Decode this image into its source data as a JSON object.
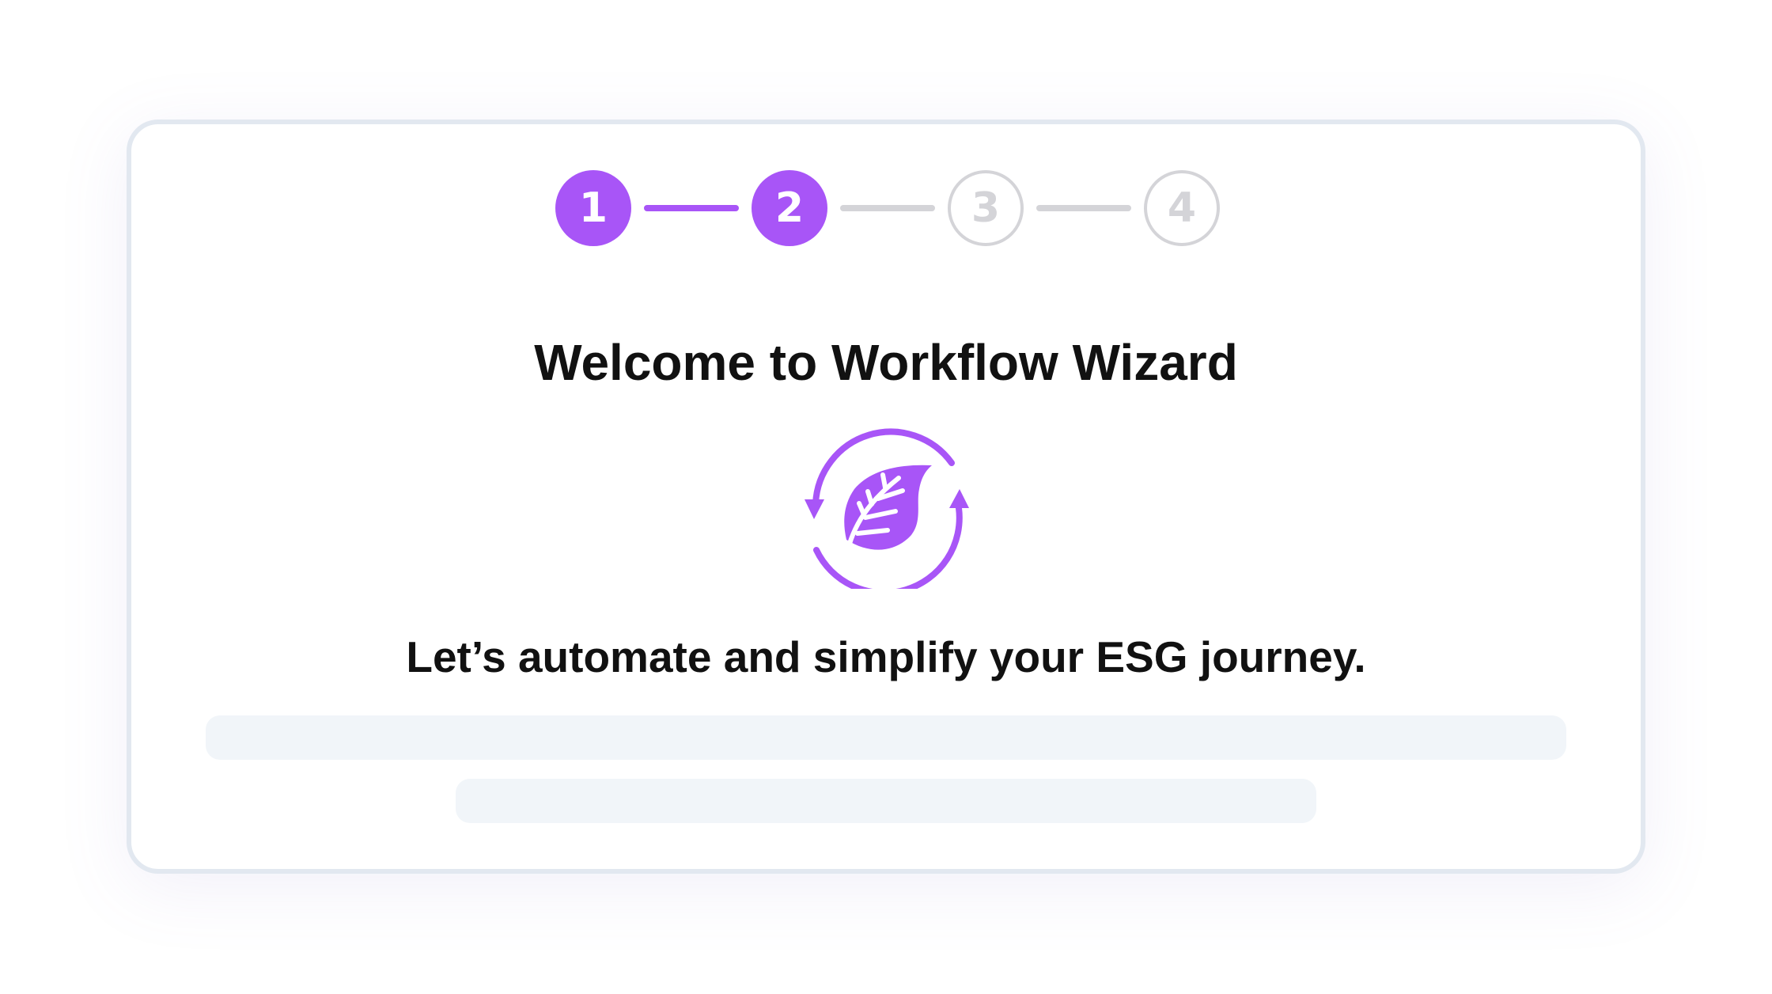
{
  "wizard": {
    "steps": [
      {
        "label": "1",
        "state": "active"
      },
      {
        "label": "2",
        "state": "active"
      },
      {
        "label": "3",
        "state": "inactive"
      },
      {
        "label": "4",
        "state": "inactive"
      }
    ],
    "title": "Welcome to Workflow Wizard",
    "icon": "leaf-cycle-icon",
    "subtitle": "Let’s automate and simplify your ESG journey."
  },
  "colors": {
    "accent": "#a855f7",
    "inactive": "#d4d4d8",
    "card_border": "#e2e8f0",
    "skeleton": "#f1f5f9",
    "text": "#111111"
  }
}
